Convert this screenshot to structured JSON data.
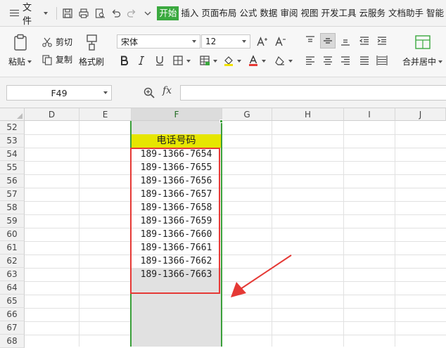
{
  "menubar": {
    "file_label": "文件",
    "tabs": [
      "开始",
      "插入",
      "页面布局",
      "公式",
      "数据",
      "审阅",
      "视图",
      "开发工具",
      "云服务",
      "文档助手",
      "智能"
    ]
  },
  "ribbon": {
    "paste": "粘贴",
    "cut": "剪切",
    "copy": "复制",
    "format_painter": "格式刷",
    "font_name": "宋体",
    "font_size": "12",
    "merge_center": "合并居中"
  },
  "formula_bar": {
    "name_box": "F49",
    "fx": "fx",
    "formula": ""
  },
  "grid": {
    "columns": [
      "D",
      "E",
      "F",
      "G",
      "H",
      "I",
      "J"
    ],
    "selected_column": "F",
    "rows": [
      "52",
      "53",
      "54",
      "55",
      "56",
      "57",
      "58",
      "59",
      "60",
      "61",
      "62",
      "63",
      "64",
      "65",
      "66",
      "67",
      "68"
    ],
    "header_cell": "电话号码",
    "phone_numbers": [
      "189-1366-7654",
      "189-1366-7655",
      "189-1366-7656",
      "189-1366-7657",
      "189-1366-7658",
      "189-1366-7659",
      "189-1366-7660",
      "189-1366-7661",
      "189-1366-7662",
      "189-1366-7663"
    ]
  },
  "colors": {
    "accent_green": "#3ba93f",
    "header_cell_fill": "#e6e600",
    "annotation_red": "#e53935"
  }
}
